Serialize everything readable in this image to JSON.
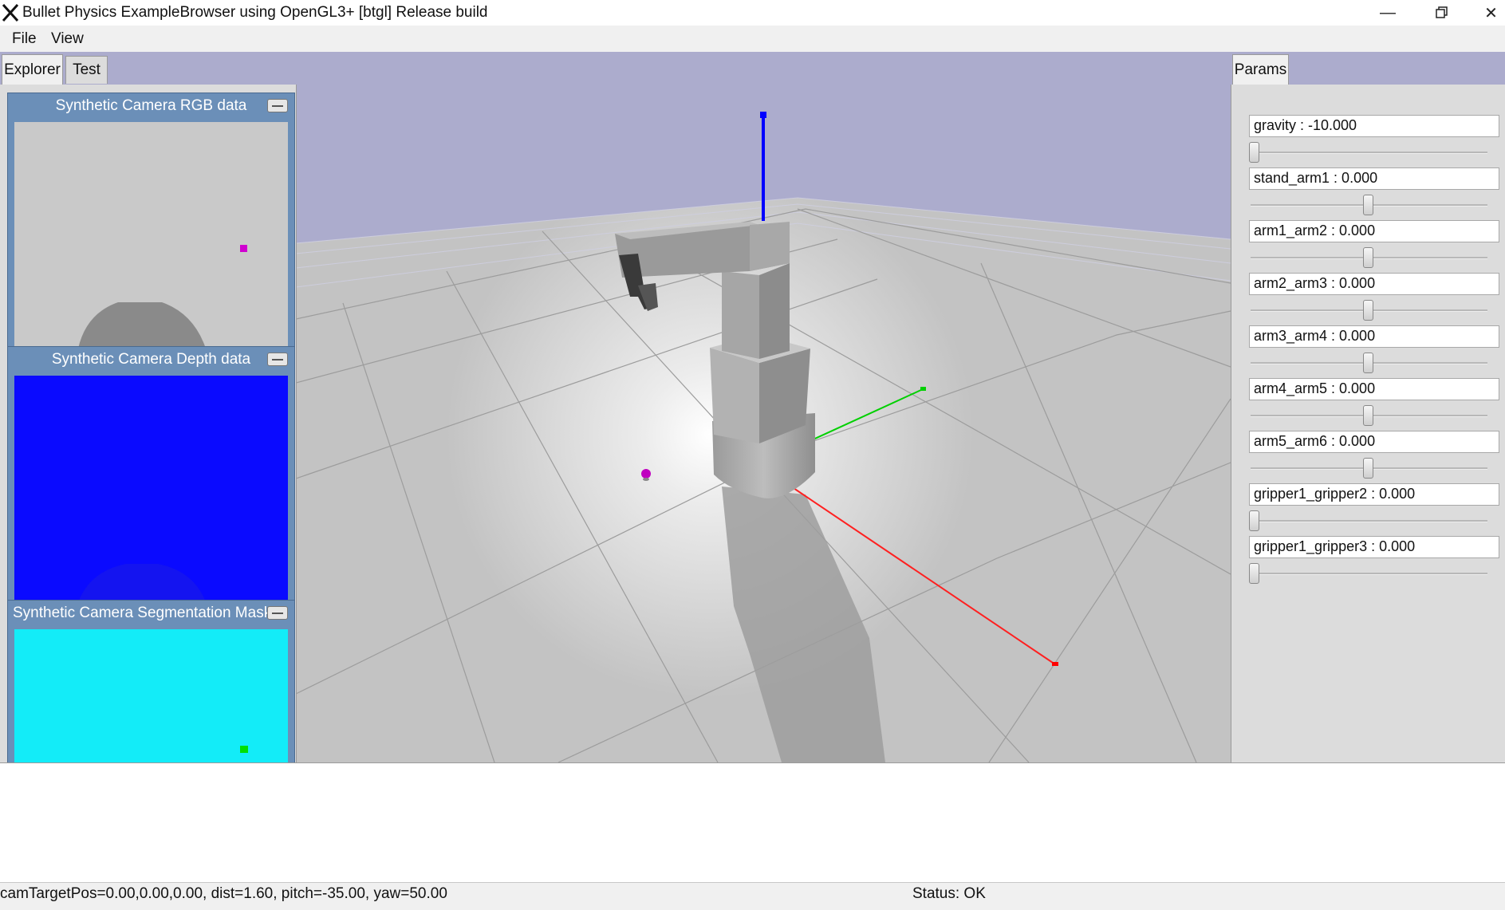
{
  "window": {
    "title": "Bullet Physics ExampleBrowser using OpenGL3+ [btgl] Release build",
    "app_icon": "x-logo-icon",
    "controls": [
      "minimize-icon",
      "restore-icon",
      "close-icon"
    ]
  },
  "menu": {
    "items": [
      "File",
      "View"
    ]
  },
  "left_tabs": [
    "Explorer",
    "Test"
  ],
  "right_tabs": [
    "Params"
  ],
  "cameras": {
    "rgb": {
      "title": "Synthetic Camera RGB data"
    },
    "depth": {
      "title": "Synthetic Camera Depth data"
    },
    "segmentation": {
      "title": "Synthetic Camera Segmentation Mask"
    }
  },
  "params": [
    {
      "label": "gravity  : -10.000",
      "value_fraction": 0.0
    },
    {
      "label": "stand_arm1 : 0.000",
      "value_fraction": 0.5
    },
    {
      "label": "arm1_arm2 : 0.000",
      "value_fraction": 0.5
    },
    {
      "label": "arm2_arm3 : 0.000",
      "value_fraction": 0.5
    },
    {
      "label": "arm3_arm4 : 0.000",
      "value_fraction": 0.5
    },
    {
      "label": "arm4_arm5 : 0.000",
      "value_fraction": 0.5
    },
    {
      "label": "arm5_arm6 : 0.000",
      "value_fraction": 0.5
    },
    {
      "label": "gripper1_gripper2  : 0.000",
      "value_fraction": 0.0
    },
    {
      "label": "gripper1_gripper3  : 0.000",
      "value_fraction": 0.0
    }
  ],
  "status": {
    "camera": "camTargetPos=0.00,0.00,0.00, dist=1.60, pitch=-35.00, yaw=50.00",
    "state": "Status: OK"
  },
  "colors": {
    "sky": "#acaccd",
    "ground": "#c6c6c6",
    "depth": "#0a0aff",
    "segmentation_bg": "#13ecf8",
    "segmentation_obj": "#1f3ef0",
    "axis_x": "#ff0000",
    "axis_y": "#00d000",
    "axis_z": "#0000ff",
    "object": "#c000c0"
  }
}
